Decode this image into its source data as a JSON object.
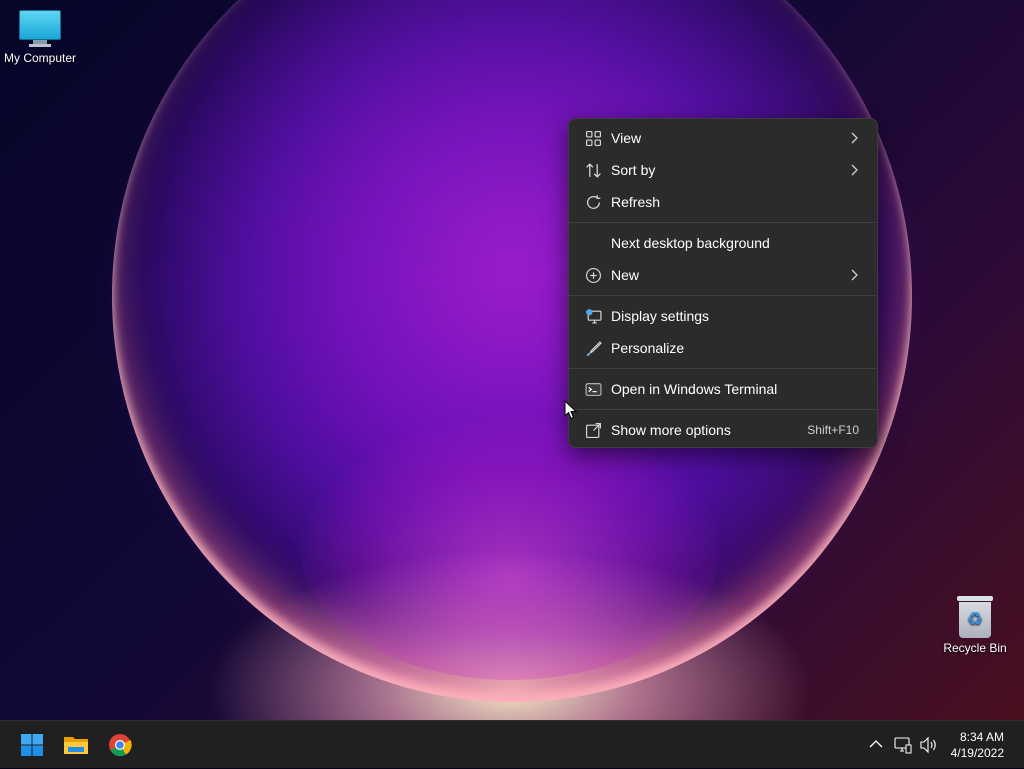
{
  "desktop": {
    "icons": [
      {
        "label": "My Computer",
        "icon": "monitor-icon"
      },
      {
        "label": "Recycle Bin",
        "icon": "recycle-bin-icon"
      }
    ]
  },
  "context_menu": {
    "items": [
      {
        "label": "View",
        "icon": "grid-icon",
        "submenu": true
      },
      {
        "label": "Sort by",
        "icon": "sort-arrows-icon",
        "submenu": true
      },
      {
        "label": "Refresh",
        "icon": "refresh-icon"
      },
      {
        "label": "Next desktop background",
        "icon": ""
      },
      {
        "label": "New",
        "icon": "plus-circle-icon",
        "submenu": true
      },
      {
        "label": "Display settings",
        "icon": "display-icon"
      },
      {
        "label": "Personalize",
        "icon": "brush-icon"
      },
      {
        "label": "Open in Windows Terminal",
        "icon": "terminal-icon"
      },
      {
        "label": "Show more options",
        "icon": "external-icon",
        "shortcut": "Shift+F10"
      }
    ]
  },
  "taskbar": {
    "apps": [
      {
        "name": "Start",
        "icon": "windows-start-icon"
      },
      {
        "name": "File Explorer",
        "icon": "folder-icon"
      },
      {
        "name": "Google Chrome",
        "icon": "chrome-icon"
      }
    ],
    "tray_icons": [
      "chevron-up-icon",
      "network-icon",
      "volume-icon"
    ],
    "clock": {
      "time": "8:34 AM",
      "date": "4/19/2022"
    }
  },
  "colors": {
    "menu_bg": "#2b2b2b",
    "taskbar_bg": "#202020",
    "accent": "#0078d4"
  }
}
